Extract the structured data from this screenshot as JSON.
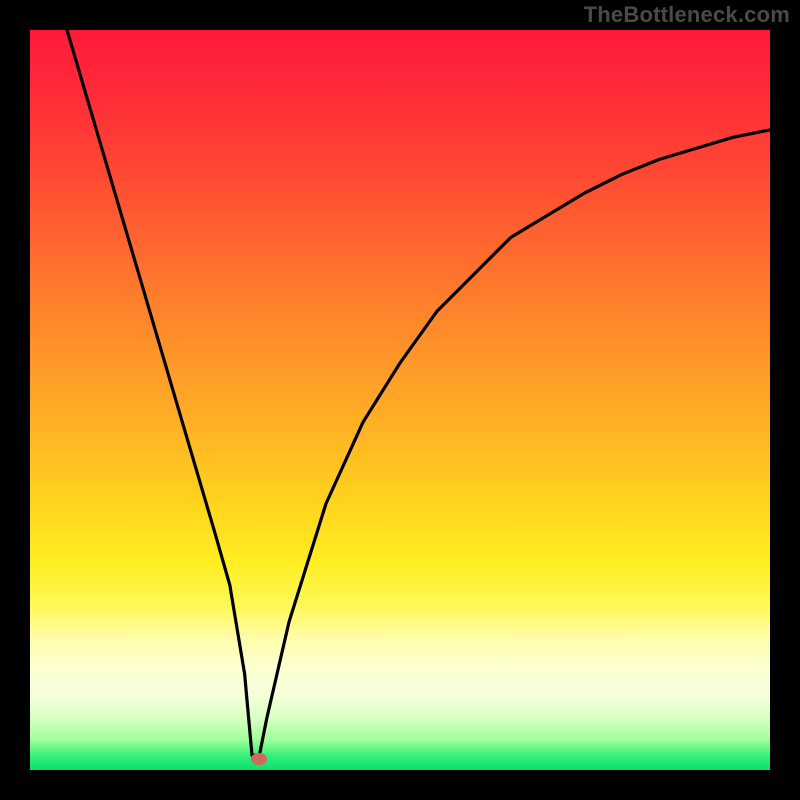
{
  "watermark": "TheBottleneck.com",
  "chart_data": {
    "type": "line",
    "title": "",
    "xlabel": "",
    "ylabel": "",
    "xlim": [
      0,
      100
    ],
    "ylim": [
      0,
      100
    ],
    "grid": false,
    "legend": false,
    "series": [
      {
        "name": "curve",
        "x": [
          5,
          10,
          15,
          20,
          25,
          27,
          29,
          30,
          31,
          32,
          35,
          40,
          45,
          50,
          55,
          60,
          65,
          70,
          75,
          80,
          85,
          90,
          95,
          100
        ],
        "y": [
          100,
          83,
          66,
          49,
          32,
          25,
          13,
          2,
          2,
          7,
          20,
          36,
          47,
          55,
          62,
          67,
          72,
          75,
          78,
          80.5,
          82.5,
          84,
          85.5,
          86.5
        ]
      }
    ],
    "marker": {
      "x": 31,
      "y": 1.5,
      "color": "#d16a5a"
    },
    "background_gradient": {
      "top": "#ff1a3a",
      "mid": "#ffd41e",
      "bottom": "#07e06c"
    }
  }
}
